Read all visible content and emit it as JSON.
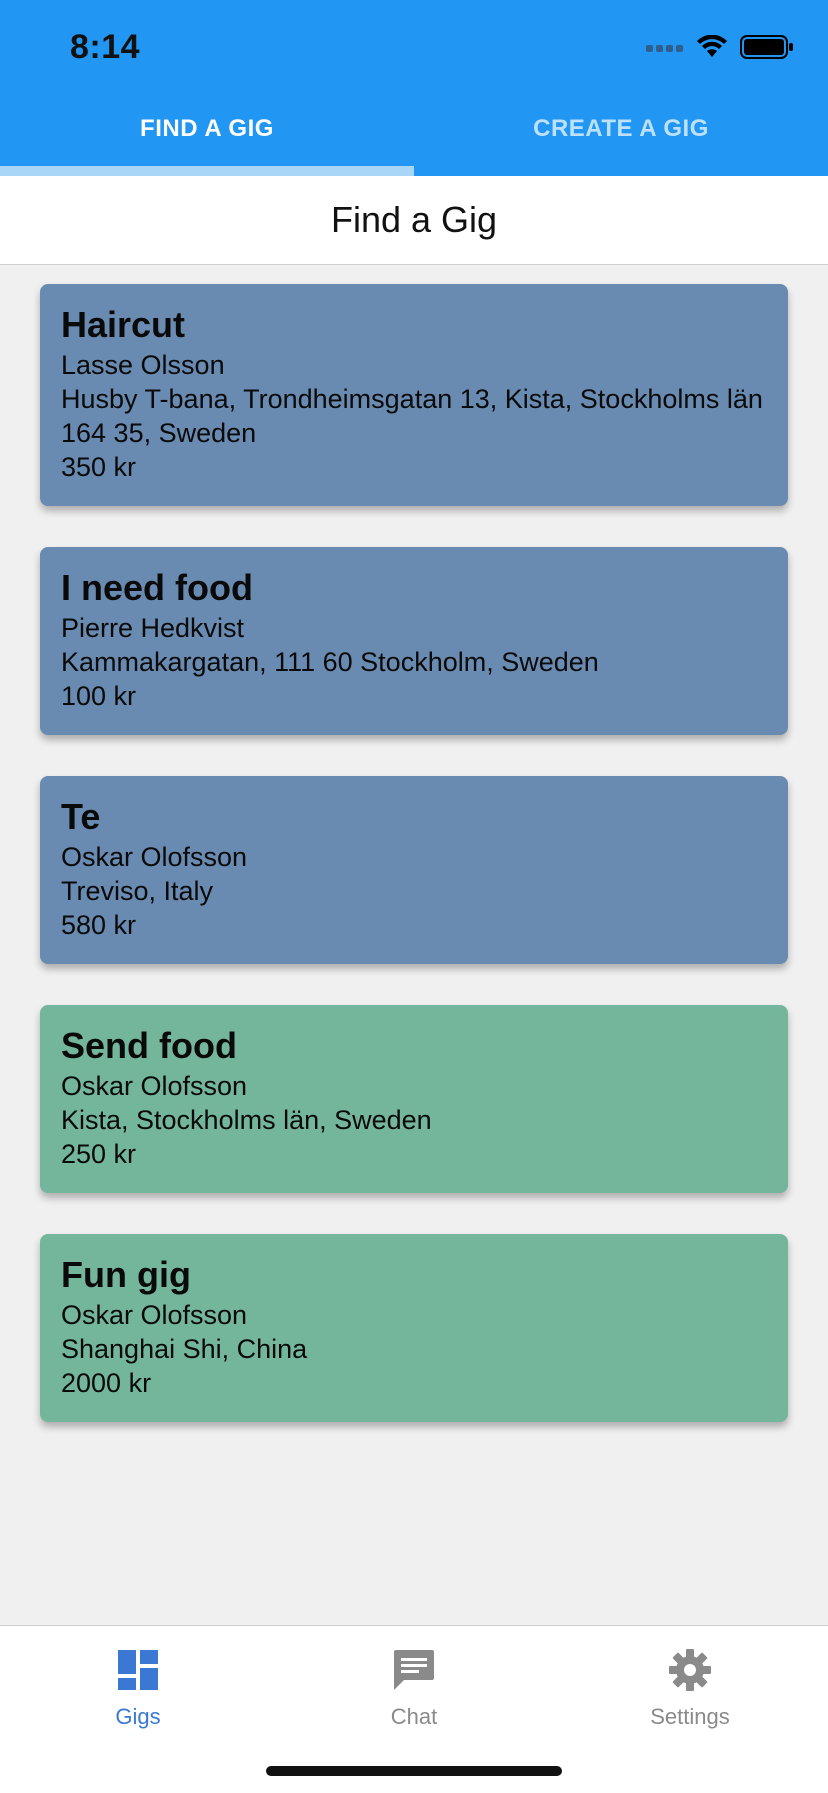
{
  "status_bar": {
    "time": "8:14"
  },
  "tabs": [
    {
      "label": "FIND A GIG",
      "active": true
    },
    {
      "label": "CREATE A GIG",
      "active": false
    }
  ],
  "header": {
    "title": "Find a Gig"
  },
  "gigs": [
    {
      "title": "Haircut",
      "person": "Lasse Olsson",
      "location": "Husby T-bana, Trondheimsgatan 13, Kista, Stockholms län 164 35, Sweden",
      "price": "350 kr",
      "color": "#6a8bb1"
    },
    {
      "title": "I need food",
      "person": "Pierre Hedkvist",
      "location": "Kammakargatan, 111 60 Stockholm, Sweden",
      "price": "100 kr",
      "color": "#6a8bb1"
    },
    {
      "title": "Te",
      "person": "Oskar Olofsson",
      "location": "Treviso, Italy",
      "price": "580 kr",
      "color": "#6a8bb1"
    },
    {
      "title": "Send food",
      "person": "Oskar Olofsson",
      "location": "Kista, Stockholms län, Sweden",
      "price": "250 kr",
      "color": "#74b69b"
    },
    {
      "title": "Fun gig",
      "person": "Oskar Olofsson",
      "location": "Shanghai Shi, China",
      "price": "2000 kr",
      "color": "#74b69b"
    }
  ],
  "bottom_nav": {
    "items": [
      {
        "label": "Gigs",
        "icon": "dashboard-icon",
        "active": true
      },
      {
        "label": "Chat",
        "icon": "chat-icon",
        "active": false
      },
      {
        "label": "Settings",
        "icon": "gear-icon",
        "active": false
      }
    ]
  },
  "colors": {
    "app_bar": "#2196f3",
    "active_nav": "#3a78d4",
    "card_blue": "#6a8bb1",
    "card_green": "#74b69b"
  }
}
